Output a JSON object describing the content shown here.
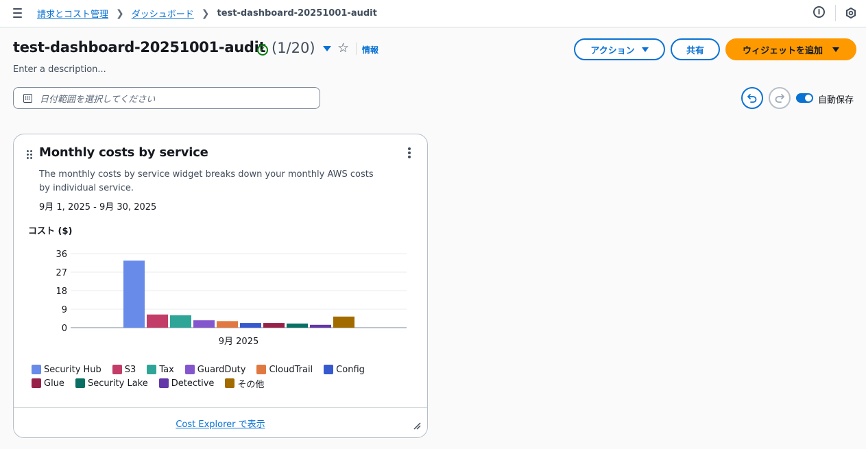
{
  "breadcrumb": {
    "items": [
      "請求とコスト管理",
      "ダッシュボード"
    ],
    "current": "test-dashboard-20251001-audit"
  },
  "header": {
    "title": "test-dashboard-20251001-audit",
    "count": "(1/20)",
    "info": "情報",
    "description": "Enter a description..."
  },
  "buttons": {
    "actions": "アクション",
    "share": "共有",
    "add_widget": "ウィジェットを追加"
  },
  "date_range": {
    "placeholder": "日付範囲を選択してください"
  },
  "autosave": {
    "label": "自動保存",
    "enabled": true
  },
  "widget": {
    "title": "Monthly costs by service",
    "description": "The monthly costs by service widget breaks down your monthly AWS costs by individual service.",
    "range": "9月 1, 2025 - 9月 30, 2025",
    "footer_link": "Cost Explorer で表示"
  },
  "chart_data": {
    "type": "bar",
    "ylabel": "コスト ($)",
    "categories": [
      "9月 2025"
    ],
    "yticks": [
      0,
      9,
      18,
      27,
      36
    ],
    "ylim": [
      0,
      36
    ],
    "grid": true,
    "legend_position": "bottom",
    "series": [
      {
        "name": "Security Hub",
        "color": "#688ae8",
        "values": [
          32.6
        ]
      },
      {
        "name": "S3",
        "color": "#c33d69",
        "values": [
          6.4
        ]
      },
      {
        "name": "Tax",
        "color": "#2ea597",
        "values": [
          6.0
        ]
      },
      {
        "name": "GuardDuty",
        "color": "#8456ce",
        "values": [
          3.6
        ]
      },
      {
        "name": "CloudTrail",
        "color": "#e07941",
        "values": [
          3.2
        ]
      },
      {
        "name": "Config",
        "color": "#3759ce",
        "values": [
          2.3
        ]
      },
      {
        "name": "Glue",
        "color": "#962249",
        "values": [
          2.3
        ]
      },
      {
        "name": "Security Lake",
        "color": "#096f64",
        "values": [
          2.0
        ]
      },
      {
        "name": "Detective",
        "color": "#6237a7",
        "values": [
          1.4
        ]
      },
      {
        "name": "その他",
        "color": "#a16b00",
        "values": [
          5.4
        ]
      }
    ]
  }
}
